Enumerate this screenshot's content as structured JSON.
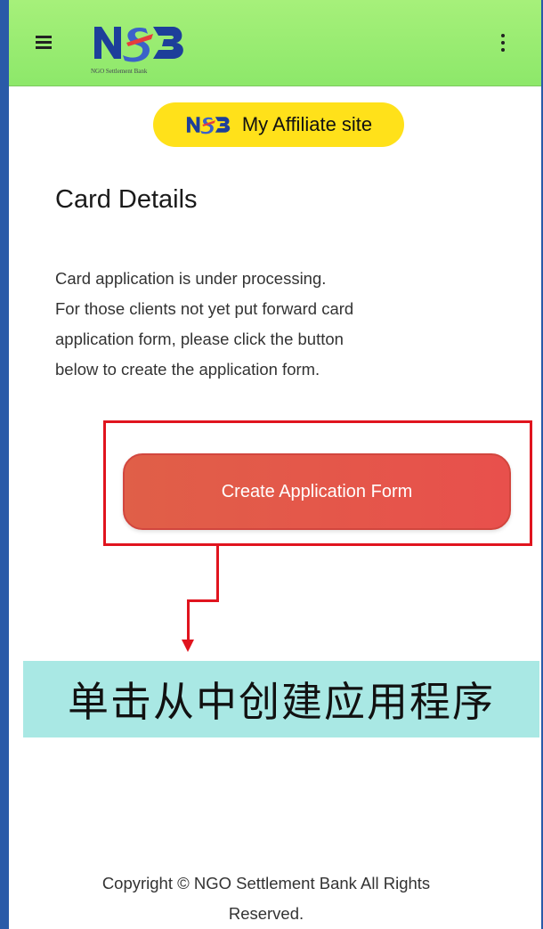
{
  "header": {
    "menu_icon": "hamburger-menu-icon",
    "logo_text": "NSB",
    "logo_subtitle": "NGO Settlement Bank",
    "more_icon": "kebab-menu-icon",
    "background_color": "#8de86a"
  },
  "affiliate": {
    "label": "My Affiliate site",
    "logo_text": "NSB",
    "background_color": "#ffe11a"
  },
  "card": {
    "title": "Card Details",
    "description_lines": [
      "Card application is under processing.",
      "For those clients not yet put forward card",
      "application form, please click the button",
      "below to create the application form."
    ],
    "button_label": "Create Application Form",
    "button_color": "#e8504c"
  },
  "annotation": {
    "text": "单击从中创建应用程序",
    "box_color": "#e0141e",
    "banner_color": "#a9e8e4"
  },
  "footer": {
    "line1": "Copyright © NGO Settlement Bank All Rights",
    "line2": "Reserved."
  }
}
